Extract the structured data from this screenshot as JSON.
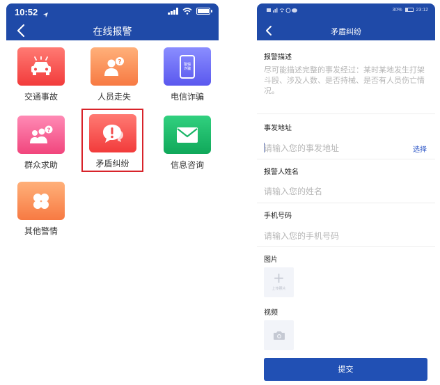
{
  "left_screen": {
    "status_bar": {
      "time": "10:52"
    },
    "header": {
      "title": "在线报警"
    },
    "tiles": [
      {
        "label": "交通事故",
        "icon": "car-accident-icon",
        "color": "#f24c4c"
      },
      {
        "label": "人员走失",
        "icon": "missing-person-icon",
        "color": "#f7874f"
      },
      {
        "label": "电信诈骗",
        "icon": "phone-fraud-icon",
        "color": "#6366f1",
        "icon_text": "警惕诈骗"
      },
      {
        "label": "群众求助",
        "icon": "group-help-icon",
        "color": "#f45a8c"
      },
      {
        "label": "矛盾纠纷",
        "icon": "dispute-icon",
        "color": "#f24c4c",
        "selected": true
      },
      {
        "label": "信息咨询",
        "icon": "mail-icon",
        "color": "#18b565"
      },
      {
        "label": "其他警情",
        "icon": "clover-icon",
        "color": "#f7874f"
      }
    ],
    "highlight_color": "#d8232a"
  },
  "right_screen": {
    "status_bar": {
      "battery": "30%",
      "time": "23:12"
    },
    "header": {
      "title": "矛盾纠纷"
    },
    "form": {
      "description_label": "报警描述",
      "description_placeholder": "尽可能描述完整的事发经过：某时某地发生打架斗殴、涉及人数、是否持械、是否有人员伤亡情况。",
      "address_label": "事发地址",
      "address_placeholder": "请输入您的事发地址",
      "address_select": "选择",
      "name_label": "报警人姓名",
      "name_placeholder": "请输入您的姓名",
      "phone_label": "手机号码",
      "phone_placeholder": "请输入您的手机号码",
      "image_label": "图片",
      "image_upload_text": "上传照片",
      "video_label": "视频",
      "submit_label": "提交"
    },
    "primary_color": "#1f4aa8"
  }
}
